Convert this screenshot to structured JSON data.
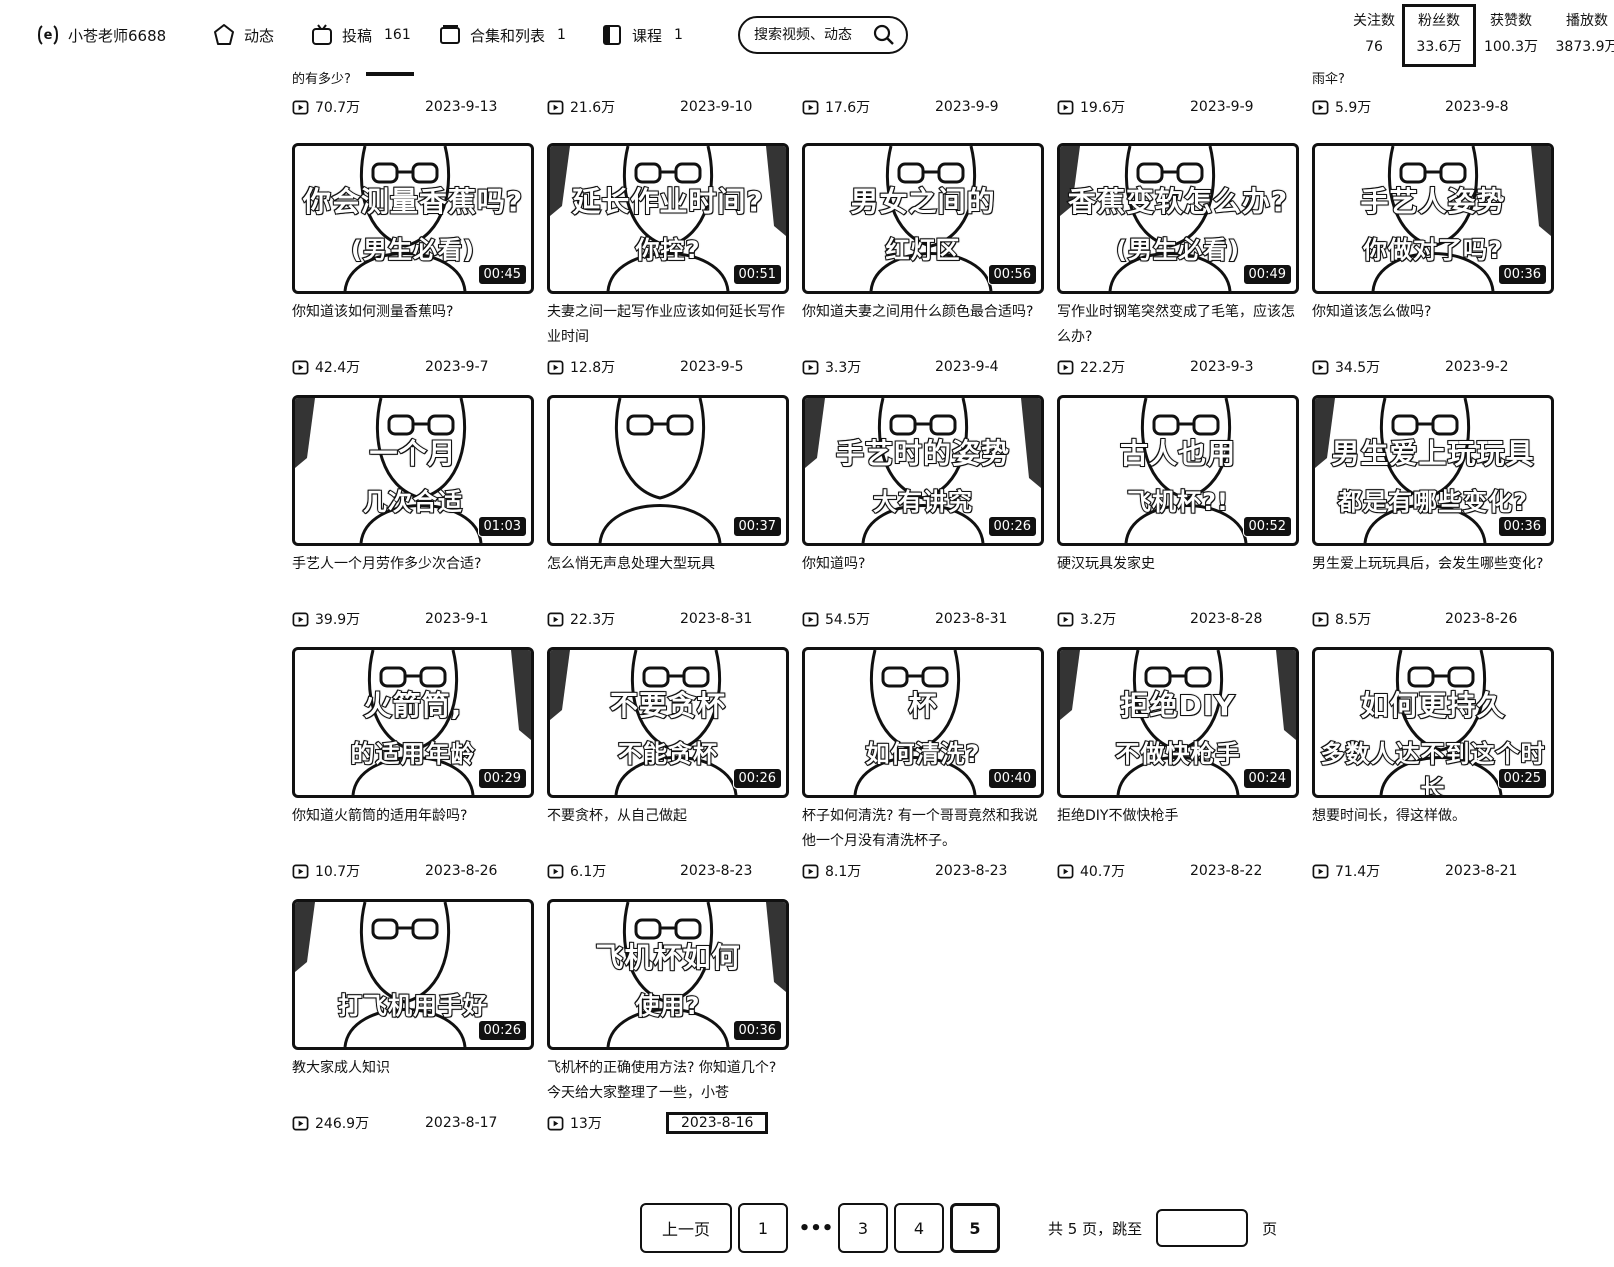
{
  "header": {
    "username": "小苍老师6688",
    "nav": [
      {
        "label": "动态",
        "count": ""
      },
      {
        "label": "投稿",
        "count": "161"
      },
      {
        "label": "合集和列表",
        "count": "1"
      },
      {
        "label": "课程",
        "count": "1"
      }
    ],
    "search_placeholder": "搜索视频、动态",
    "stats": [
      {
        "label": "关注数",
        "value": "76"
      },
      {
        "label": "粉丝数",
        "value": "33.6万"
      },
      {
        "label": "获赞数",
        "value": "100.3万"
      },
      {
        "label": "播放数",
        "value": "3873.9万"
      }
    ]
  },
  "top_row": [
    {
      "title": "的有多少?",
      "views": "70.7万",
      "date": "2023-9-13"
    },
    {
      "title": "",
      "views": "21.6万",
      "date": "2023-9-10"
    },
    {
      "title": "",
      "views": "17.6万",
      "date": "2023-9-9"
    },
    {
      "title": "",
      "views": "19.6万",
      "date": "2023-9-9"
    },
    {
      "title": "雨伞?",
      "views": "5.9万",
      "date": "2023-9-8"
    }
  ],
  "videos": [
    {
      "overlay1": "你会测量香蕉吗?",
      "overlay2": "(男生必看)",
      "duration": "00:45",
      "title": "你知道该如何测量香蕉吗?",
      "views": "42.4万",
      "date": "2023-9-7"
    },
    {
      "overlay1": "延长作业时间?",
      "overlay2": "你控?",
      "duration": "00:51",
      "title": "夫妻之间一起写作业应该如何延长写作业时间",
      "views": "12.8万",
      "date": "2023-9-5"
    },
    {
      "overlay1": "男女之间的",
      "overlay2": "红灯区",
      "duration": "00:56",
      "title": "你知道夫妻之间用什么颜色最合适吗?",
      "views": "3.3万",
      "date": "2023-9-4"
    },
    {
      "overlay1": "香蕉变软怎么办?",
      "overlay2": "(男生必看)",
      "duration": "00:49",
      "title": "写作业时钢笔突然变成了毛笔，应该怎么办?",
      "views": "22.2万",
      "date": "2023-9-3"
    },
    {
      "overlay1": "手艺人姿势",
      "overlay2": "你做对了吗?",
      "duration": "00:36",
      "title": "你知道该怎么做吗?",
      "views": "34.5万",
      "date": "2023-9-2"
    },
    {
      "overlay1": "一个月",
      "overlay2": "几次合适",
      "duration": "01:03",
      "title": "手艺人一个月劳作多少次合适?",
      "views": "39.9万",
      "date": "2023-9-1"
    },
    {
      "overlay1": "",
      "overlay2": "",
      "duration": "00:37",
      "title": "怎么悄无声息处理大型玩具",
      "views": "22.3万",
      "date": "2023-8-31"
    },
    {
      "overlay1": "手艺时的姿势",
      "overlay2": "大有讲究",
      "duration": "00:26",
      "title": "你知道吗?",
      "views": "54.5万",
      "date": "2023-8-31"
    },
    {
      "overlay1": "古人也用",
      "overlay2": "飞机杯?!",
      "duration": "00:52",
      "title": "硬汉玩具发家史",
      "views": "3.2万",
      "date": "2023-8-28"
    },
    {
      "overlay1": "男生爱上玩玩具",
      "overlay2": "都是有哪些变化?",
      "duration": "00:36",
      "title": "男生爱上玩玩具后，会发生哪些变化?",
      "views": "8.5万",
      "date": "2023-8-26"
    },
    {
      "overlay1": "火箭筒,",
      "overlay2": "的适用年龄",
      "duration": "00:29",
      "title": "你知道火箭筒的适用年龄吗?",
      "views": "10.7万",
      "date": "2023-8-26"
    },
    {
      "overlay1": "不要贪杯",
      "overlay2": "不能贪杯",
      "duration": "00:26",
      "title": "不要贪杯，从自己做起",
      "views": "6.1万",
      "date": "2023-8-23"
    },
    {
      "overlay1": "杯",
      "overlay2": "如何清洗?",
      "duration": "00:40",
      "title": "杯子如何清洗? 有一个哥哥竟然和我说他一个月没有清洗杯子。",
      "views": "8.1万",
      "date": "2023-8-23"
    },
    {
      "overlay1": "拒绝DIY",
      "overlay2": "不做快枪手",
      "duration": "00:24",
      "title": "拒绝DIY不做快枪手",
      "views": "40.7万",
      "date": "2023-8-22"
    },
    {
      "overlay1": "如何更持久",
      "overlay2": "多数人达不到这个时长",
      "duration": "00:25",
      "title": "想要时间长，得这样做。",
      "views": "71.4万",
      "date": "2023-8-21"
    },
    {
      "overlay1": "",
      "overlay2": "打飞机用手好",
      "duration": "00:26",
      "title": "教大家成人知识",
      "views": "246.9万",
      "date": "2023-8-17"
    },
    {
      "overlay1": "飞机杯如何",
      "overlay2": "使用?",
      "duration": "00:36",
      "title": "飞机杯的正确使用方法? 你知道几个? 今天给大家整理了一些，小苍",
      "views": "13万",
      "date": "2023-8-16"
    }
  ],
  "pager": {
    "prev": "上一页",
    "pages": [
      "1",
      "3",
      "4",
      "5"
    ],
    "ellipsis": "•••",
    "total_text": "共 5 页，跳至",
    "unit": "页"
  }
}
